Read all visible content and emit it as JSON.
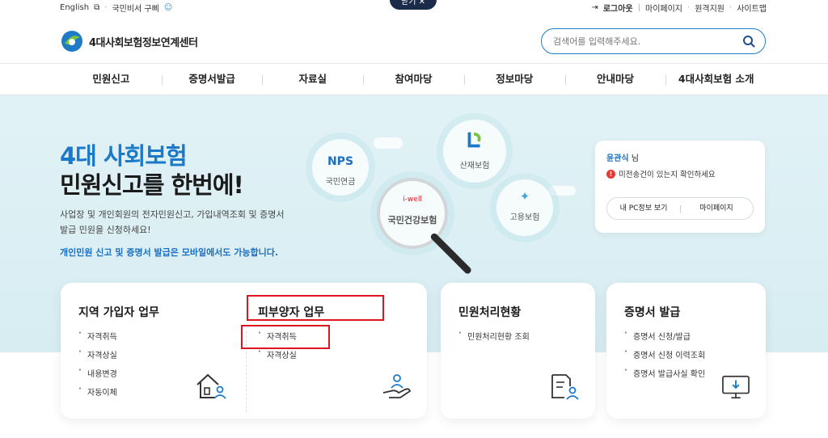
{
  "util": {
    "english": "English",
    "lang_site": "국민비서 구삐",
    "logout": "로그아웃",
    "mypage": "마이페이지",
    "remote": "원격지원",
    "sitemap": "사이트맵",
    "close": "닫기 ✕"
  },
  "header": {
    "logo_text": "4대사회보험정보연계센터",
    "search_placeholder": "검색어를 입력해주세요."
  },
  "gnb": [
    "민원신고",
    "증명서발급",
    "자료실",
    "참여마당",
    "정보마당",
    "안내마당",
    "4대사회보험 소개"
  ],
  "hero": {
    "title1": "4대 사회보험",
    "title2": "민원신고를 한번에!",
    "desc": "사업장 및 개인회원의 전자민원신고, 가입내역조회 및 증명서 발급 민원을 신청하세요!",
    "mobile_note": "개인민원 신고 및 증명서 발급은 모바일에서도 가능합니다.",
    "bubbles": {
      "nps_logo": "NPS",
      "nps_label": "국민연금",
      "comwel_label": "산재보험",
      "nhis_label": "국민건강보험",
      "nhis_logo": "i-well",
      "ei_label": "고용보험"
    }
  },
  "user": {
    "name": "윤관식",
    "suffix": "님",
    "alert": "미전송건이 있는지 확인하세요",
    "btn_pc": "내 PC정보 보기",
    "btn_mypage": "마이페이지"
  },
  "cards": {
    "regional": {
      "title": "지역 가입자 업무",
      "items": [
        "자격취득",
        "자격상실",
        "내용변경",
        "자동이체"
      ]
    },
    "dependent": {
      "title": "피부양자 업무",
      "items": [
        "자격취득",
        "자격상실"
      ]
    },
    "status": {
      "title": "민원처리현황",
      "items": [
        "민원처리현황 조회"
      ]
    },
    "cert": {
      "title": "증명서 발급",
      "items": [
        "증명서 신청/발급",
        "증명서 신청 이력조회",
        "증명서 발급사실 확인"
      ]
    }
  },
  "colors": {
    "accent": "#1c79c8",
    "highlight": "#e0141e",
    "hero_bg": "#dbeff4"
  }
}
